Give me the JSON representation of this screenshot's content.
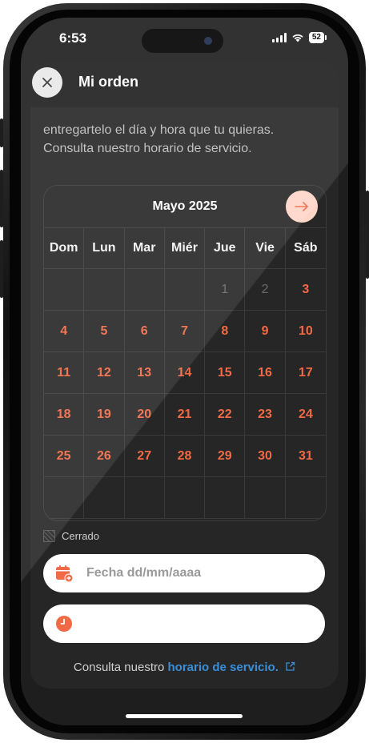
{
  "status_bar": {
    "time": "6:53",
    "battery": "52"
  },
  "header": {
    "title": "Mi orden"
  },
  "description": "entregartelo el día y hora que tu quieras. Consulta nuestro horario de servicio.",
  "calendar": {
    "month": "Mayo 2025",
    "weekdays": [
      "Dom",
      "Lun",
      "Mar",
      "Miér",
      "Jue",
      "Vie",
      "Sáb"
    ],
    "weeks": [
      [
        "",
        "",
        "",
        "",
        "1",
        "2",
        "3"
      ],
      [
        "4",
        "5",
        "6",
        "7",
        "8",
        "9",
        "10"
      ],
      [
        "11",
        "12",
        "13",
        "14",
        "15",
        "16",
        "17"
      ],
      [
        "18",
        "19",
        "20",
        "21",
        "22",
        "23",
        "24"
      ],
      [
        "25",
        "26",
        "27",
        "28",
        "29",
        "30",
        "31"
      ],
      [
        "",
        "",
        "",
        "",
        "",
        "",
        ""
      ]
    ],
    "disabled_days": [
      "1",
      "2"
    ]
  },
  "legend": {
    "closed_label": "Cerrado"
  },
  "date_field": {
    "placeholder": "Fecha dd/mm/aaaa",
    "value": ""
  },
  "time_field": {
    "placeholder": "",
    "value": ""
  },
  "footer": {
    "prefix": "Consulta nuestro",
    "link": "horario de servicio."
  },
  "colors": {
    "accent": "#f06a45",
    "link": "#3a8fd8",
    "background": "#262626"
  },
  "icons": {
    "close": "close-icon",
    "next": "arrow-right-icon",
    "date": "calendar-add-icon",
    "time": "clock-icon",
    "external": "external-link-icon"
  }
}
